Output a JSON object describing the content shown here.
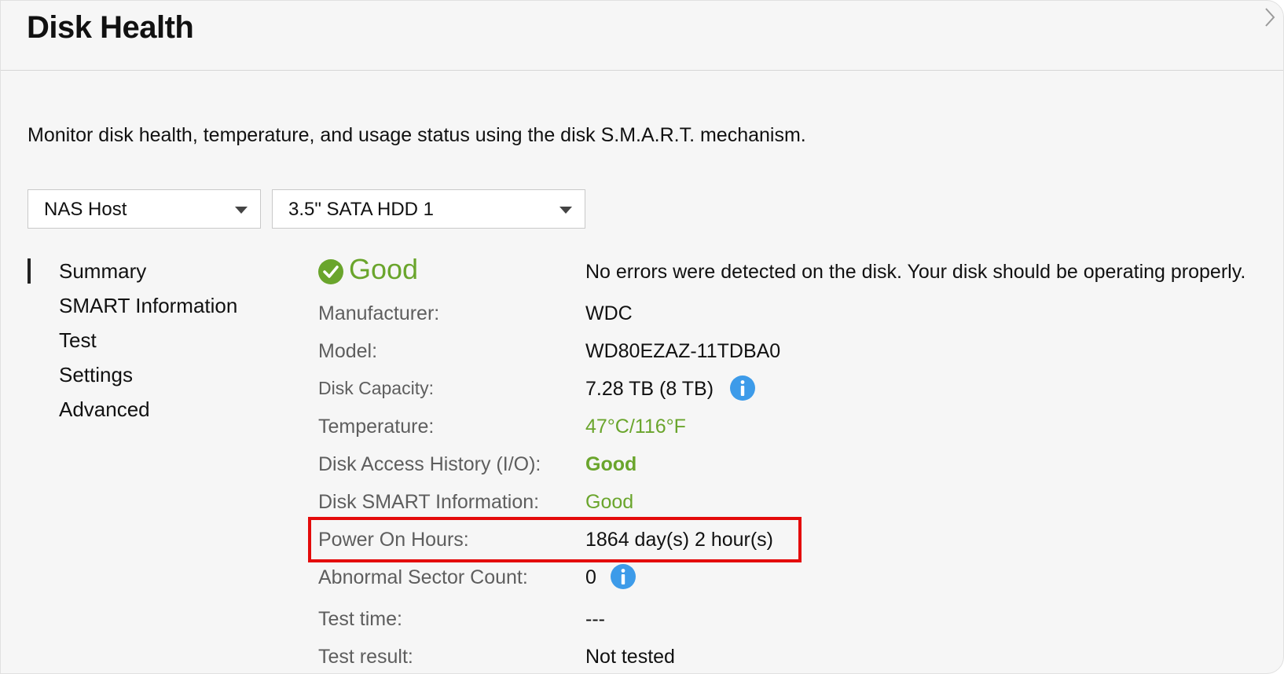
{
  "header": {
    "title": "Disk Health"
  },
  "description": "Monitor disk health, temperature, and usage status using the disk S.M.A.R.T. mechanism.",
  "selectors": {
    "host": "NAS Host",
    "disk": "3.5\" SATA HDD 1"
  },
  "nav": {
    "items": [
      {
        "label": "Summary",
        "active": true
      },
      {
        "label": "SMART Information",
        "active": false
      },
      {
        "label": "Test",
        "active": false
      },
      {
        "label": "Settings",
        "active": false
      },
      {
        "label": "Advanced",
        "active": false
      }
    ]
  },
  "summary": {
    "status": "Good",
    "status_message": "No errors were detected on the disk. Your disk should be operating properly.",
    "rows": [
      {
        "label": "Manufacturer:",
        "value": "WDC"
      },
      {
        "label": "Model:",
        "value": "WD80EZAZ-11TDBA0"
      },
      {
        "label": "Disk Capacity:",
        "value": "7.28 TB (8 TB)"
      },
      {
        "label": "Temperature:",
        "value": "47°C/116°F"
      },
      {
        "label": "Disk Access History (I/O):",
        "value": "Good"
      },
      {
        "label": "Disk SMART Information:",
        "value": "Good"
      },
      {
        "label": "Power On Hours:",
        "value": "1864 day(s) 2 hour(s)"
      },
      {
        "label": "Abnormal Sector Count:",
        "value": "0"
      },
      {
        "label": "Test time:",
        "value": "---"
      },
      {
        "label": "Test result:",
        "value": "Not tested"
      }
    ]
  },
  "icons": {
    "status": "check-circle-icon",
    "info": "info-icon",
    "close": "chevron-right-icon",
    "dropdown": "caret-down-icon"
  },
  "colors": {
    "good_green": "#6aa52c",
    "info_blue": "#3d9be9",
    "highlight_red": "#e40b0b",
    "background": "#f6f6f6"
  }
}
